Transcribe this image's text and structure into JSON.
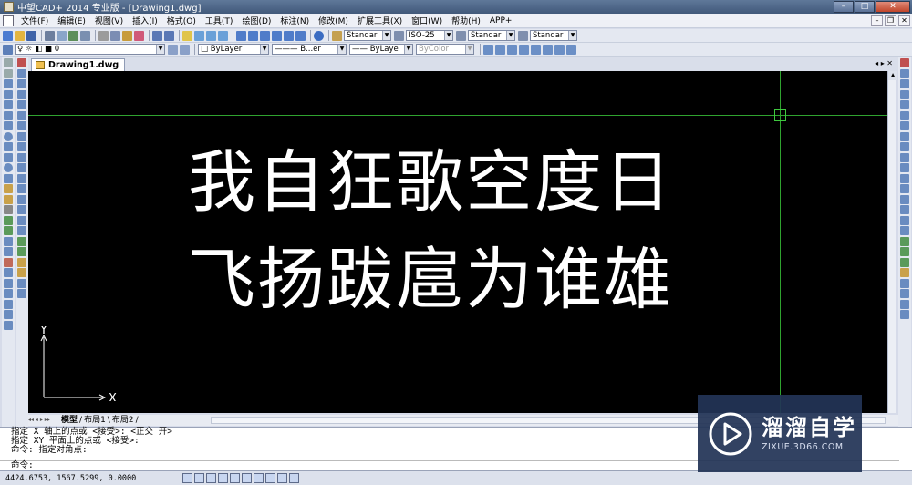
{
  "window": {
    "title": "中望CAD+ 2014 专业版 - [Drawing1.dwg]"
  },
  "menu": {
    "items": [
      "文件(F)",
      "编辑(E)",
      "视图(V)",
      "插入(I)",
      "格式(O)",
      "工具(T)",
      "绘图(D)",
      "标注(N)",
      "修改(M)",
      "扩展工具(X)",
      "窗口(W)",
      "帮助(H)",
      "APP+"
    ]
  },
  "toolbar1": {
    "text_style": "Standar",
    "dim_style": "ISO-25",
    "table_style": "Standar",
    "multileader_style": "Standar"
  },
  "toolbar2": {
    "layer": "0",
    "color": "ByLayer",
    "linetype": "B...er",
    "lineweight": "ByLaye",
    "plot_style": "ByColor"
  },
  "document": {
    "tab_label": "Drawing1.dwg"
  },
  "canvas": {
    "line1": "我自狂歌空度日",
    "line2": "飞扬跋扈为谁雄",
    "ucs_x": "X",
    "ucs_y": "Y",
    "background": "#000000",
    "crosshair_color": "#2fa32f"
  },
  "layout_tabs": [
    "模型",
    "布局1",
    "布局2"
  ],
  "command": {
    "history": [
      "指定 X 轴上的点或 <接受>: <正交 开>",
      "指定 XY 平面上的点或 <接受>:",
      "命令: 指定对角点:"
    ],
    "prompt": "命令:"
  },
  "status": {
    "coordinates": "4424.6753, 1567.5299, 0.0000"
  },
  "watermark": {
    "title": "溜溜自学",
    "url": "ZIXUE.3D66.COM"
  }
}
